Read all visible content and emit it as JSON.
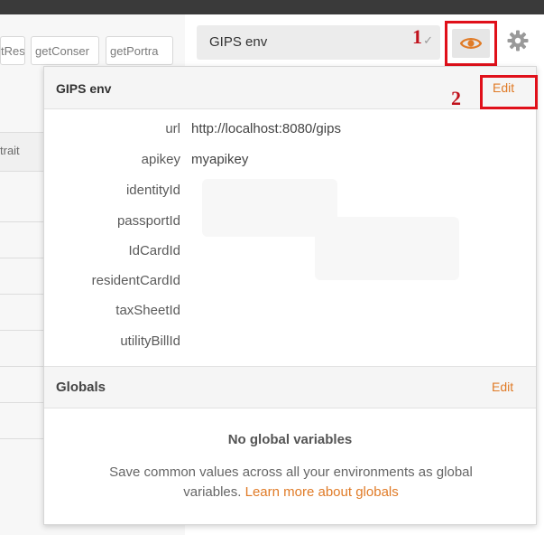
{
  "tabs": [
    "tRes",
    "getConser",
    "getPortra"
  ],
  "grid": {
    "column_header": "trait"
  },
  "header": {
    "env_select_value": "GIPS env",
    "annotation_1": "1",
    "annotation_2": "2",
    "eye_icon": "eye-icon",
    "settings_icon": "gear-icon"
  },
  "environment": {
    "title": "GIPS env",
    "edit_label": "Edit",
    "variables": [
      {
        "key": "url",
        "value": "http://localhost:8080/gips"
      },
      {
        "key": "apikey",
        "value": "myapikey"
      },
      {
        "key": "identityId",
        "value": ""
      },
      {
        "key": "passportId",
        "value": ""
      },
      {
        "key": "IdCardId",
        "value": ""
      },
      {
        "key": "residentCardId",
        "value": ""
      },
      {
        "key": "taxSheetId",
        "value": ""
      },
      {
        "key": "utilityBillId",
        "value": ""
      }
    ]
  },
  "globals": {
    "title": "Globals",
    "edit_label": "Edit",
    "empty_title": "No global variables",
    "empty_desc": "Save common values across all your environments as global variables.",
    "learn_more": "Learn more about globals"
  },
  "colors": {
    "accent": "#e07b27",
    "annotation": "#e0101a"
  }
}
